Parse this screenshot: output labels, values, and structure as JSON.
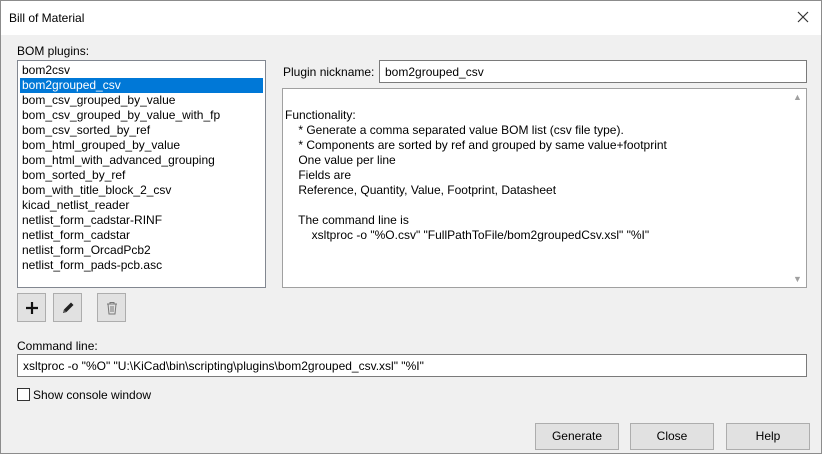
{
  "window": {
    "title": "Bill of Material"
  },
  "bom_plugins": {
    "label": "BOM plugins:",
    "items": [
      "bom2csv",
      "bom2grouped_csv",
      "bom_csv_grouped_by_value",
      "bom_csv_grouped_by_value_with_fp",
      "bom_csv_sorted_by_ref",
      "bom_html_grouped_by_value",
      "bom_html_with_advanced_grouping",
      "bom_sorted_by_ref",
      "bom_with_title_block_2_csv",
      "kicad_netlist_reader",
      "netlist_form_cadstar-RINF",
      "netlist_form_cadstar",
      "netlist_form_OrcadPcb2",
      "netlist_form_pads-pcb.asc"
    ],
    "selected": "bom2grouped_csv"
  },
  "plugin_nickname": {
    "label": "Plugin nickname:",
    "value": "bom2grouped_csv"
  },
  "functionality": {
    "lines": [
      "Functionality:",
      "    * Generate a comma separated value BOM list (csv file type).",
      "    * Components are sorted by ref and grouped by same value+footprint",
      "    One value per line",
      "    Fields are",
      "    Reference, Quantity, Value, Footprint, Datasheet",
      "",
      "    The command line is",
      "        xsltproc -o \"%O.csv\" \"FullPathToFile/bom2groupedCsv.xsl\" \"%I\""
    ]
  },
  "toolbar": {
    "add_icon": "plus-icon",
    "edit_icon": "pencil-icon",
    "remove_icon": "trash-icon"
  },
  "command_line": {
    "label": "Command line:",
    "value": "xsltproc -o \"%O\" \"U:\\KiCad\\bin\\scripting\\plugins\\bom2grouped_csv.xsl\" \"%I\""
  },
  "show_console": {
    "label": "Show console window",
    "checked": false
  },
  "buttons": {
    "generate": "Generate",
    "close": "Close",
    "help": "Help"
  },
  "colors": {
    "selection": "#0078d7",
    "dialog_bg": "#f0f0f0"
  }
}
